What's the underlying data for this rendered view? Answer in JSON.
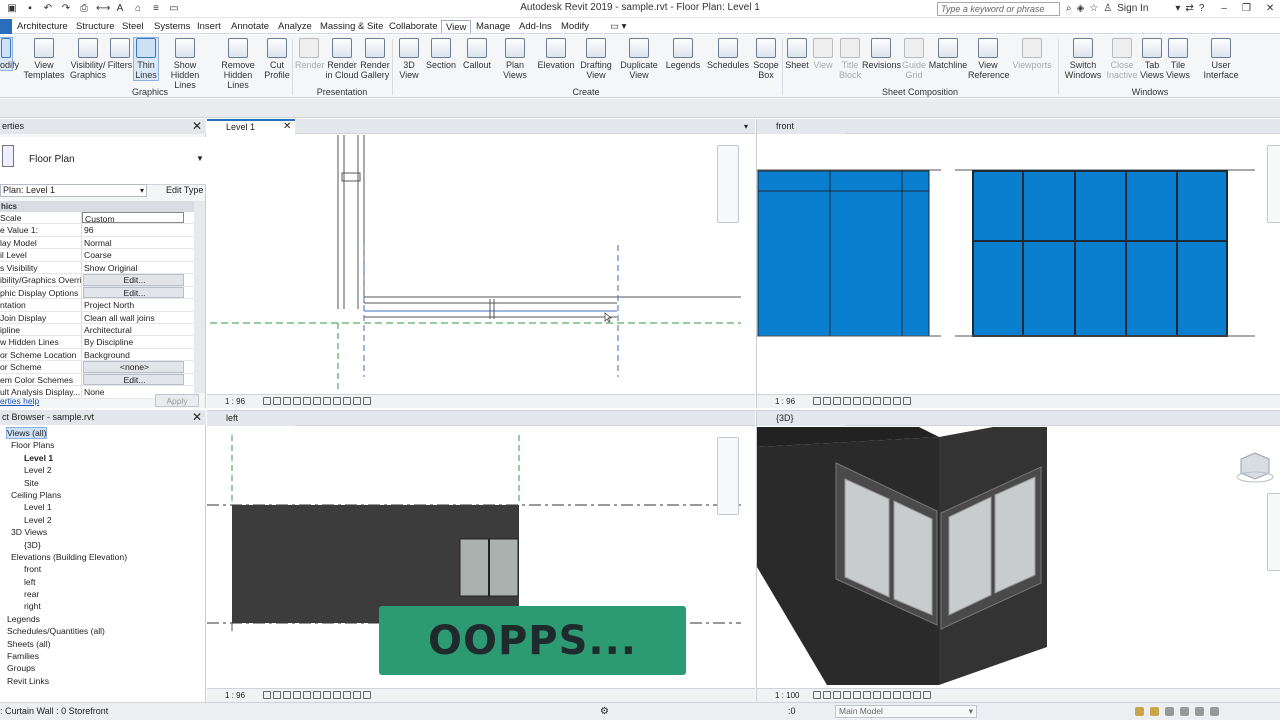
{
  "window": {
    "title": "Autodesk Revit 2019 - sample.rvt - Floor Plan: Level 1",
    "search_placeholder": "Type a keyword or phrase",
    "sign_in": "Sign In"
  },
  "menu": {
    "tabs": [
      "Architecture",
      "Structure",
      "Steel",
      "Systems",
      "Insert",
      "Annotate",
      "Analyze",
      "Massing & Site",
      "Collaborate",
      "View",
      "Manage",
      "Add-Ins",
      "Modify"
    ],
    "active": "View"
  },
  "ribbon": {
    "panels": {
      "graphics": "Graphics",
      "presentation": "Presentation",
      "create": "Create",
      "sheet_composition": "Sheet Composition",
      "windows": "Windows"
    },
    "buttons": {
      "modify": "odify",
      "view_templates": "View Templates",
      "visibility": "Visibility/ Graphics",
      "filters": "Filters",
      "thin_lines": "Thin Lines",
      "show_hidden": "Show Hidden Lines",
      "remove_hidden": "Remove Hidden Lines",
      "cut_profile": "Cut Profile",
      "render": "Render",
      "render_cloud": "Render in Cloud",
      "render_gallery": "Render Gallery",
      "view3d": "3D View",
      "section": "Section",
      "callout": "Callout",
      "plan_views": "Plan Views",
      "elevation": "Elevation",
      "drafting_view": "Drafting View",
      "duplicate_view": "Duplicate View",
      "legends": "Legends",
      "schedules": "Schedules",
      "scope_box": "Scope Box",
      "sheet": "Sheet",
      "view": "View",
      "title_block": "Title Block",
      "revisions": "Revisions",
      "guide_grid": "Guide Grid",
      "matchline": "Matchline",
      "view_reference": "View Reference",
      "viewports": "Viewports",
      "switch_windows": "Switch Windows",
      "close_inactive": "Close Inactive",
      "tab_views": "Tab Views",
      "tile_views": "Tile Views",
      "user_interface": "User Interface"
    }
  },
  "properties": {
    "header": "erties",
    "type_name": "Floor Plan",
    "instance_selector": "Plan: Level 1",
    "edit_type": "Edit Type",
    "group": "hics",
    "rows": [
      {
        "k": "Scale",
        "v": "Custom",
        "kind": "field"
      },
      {
        "k": "e Value    1:",
        "v": "96",
        "kind": "text"
      },
      {
        "k": "lay Model",
        "v": "Normal",
        "kind": "text"
      },
      {
        "k": "il Level",
        "v": "Coarse",
        "kind": "text"
      },
      {
        "k": "s Visibility",
        "v": "Show Original",
        "kind": "text"
      },
      {
        "k": "ibility/Graphics Overri...",
        "v": "Edit...",
        "kind": "btn"
      },
      {
        "k": "phic Display Options",
        "v": "Edit...",
        "kind": "btn"
      },
      {
        "k": "ntation",
        "v": "Project North",
        "kind": "text"
      },
      {
        "k": " Join Display",
        "v": "Clean all wall joins",
        "kind": "text"
      },
      {
        "k": "ipline",
        "v": "Architectural",
        "kind": "text"
      },
      {
        "k": "w Hidden Lines",
        "v": "By Discipline",
        "kind": "text"
      },
      {
        "k": "or Scheme Location",
        "v": "Background",
        "kind": "text"
      },
      {
        "k": "or Scheme",
        "v": "<none>",
        "kind": "btn"
      },
      {
        "k": "em Color Schemes",
        "v": "Edit...",
        "kind": "btn"
      },
      {
        "k": "ult Analysis Display...",
        "v": "None",
        "kind": "text"
      }
    ],
    "help": "erties help",
    "apply": "Apply"
  },
  "browser": {
    "header": "ct Browser - sample.rvt",
    "nodes": [
      {
        "t": "Views (all)",
        "d": 0,
        "hl": true
      },
      {
        "t": "Floor Plans",
        "d": 1
      },
      {
        "t": "Level 1",
        "d": 2,
        "bold": true
      },
      {
        "t": "Level 2",
        "d": 2
      },
      {
        "t": "Site",
        "d": 2
      },
      {
        "t": "Ceiling Plans",
        "d": 1
      },
      {
        "t": "Level 1",
        "d": 2
      },
      {
        "t": "Level 2",
        "d": 2
      },
      {
        "t": "3D Views",
        "d": 1
      },
      {
        "t": "{3D}",
        "d": 2
      },
      {
        "t": "Elevations (Building Elevation)",
        "d": 1
      },
      {
        "t": "front",
        "d": 2
      },
      {
        "t": "left",
        "d": 2
      },
      {
        "t": "rear",
        "d": 2
      },
      {
        "t": "right",
        "d": 2
      },
      {
        "t": "Legends",
        "d": 0
      },
      {
        "t": "Schedules/Quantities (all)",
        "d": 0
      },
      {
        "t": "Sheets (all)",
        "d": 0
      },
      {
        "t": "Families",
        "d": 0
      },
      {
        "t": "Groups",
        "d": 0
      },
      {
        "t": "Revit Links",
        "d": 0
      }
    ]
  },
  "views": {
    "level1": {
      "title": "Level 1",
      "scale": "1 : 96"
    },
    "front": {
      "title": "front",
      "scale": "1 : 96"
    },
    "left": {
      "title": "left",
      "scale": "1 : 96"
    },
    "threed": {
      "title": "{3D}",
      "scale": "1 : 100"
    }
  },
  "status": {
    "message": ": Curtain Wall : 0 Storefront",
    "zero": ":0",
    "model": "Main Model"
  },
  "overlay": {
    "text": "OOPPS..."
  },
  "colors": {
    "accent": "#2a6ebb",
    "glass": "#0a7fcf",
    "wall": "#3c3c3c",
    "banner": "#2c9a72"
  }
}
